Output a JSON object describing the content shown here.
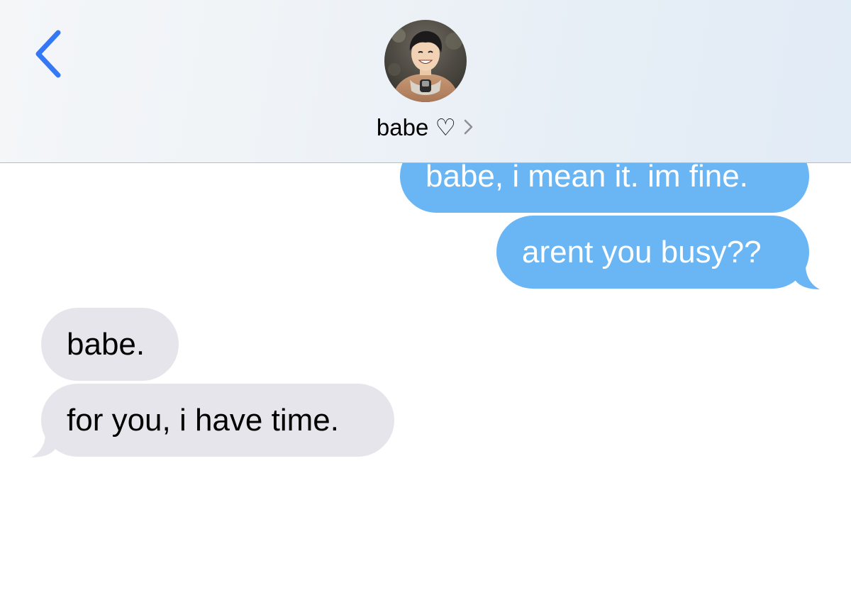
{
  "header": {
    "back_icon": "chevron-left-icon",
    "contact_name": "babe ♡",
    "details_icon": "chevron-right-icon",
    "avatar_icon": "contact-avatar-photo"
  },
  "messages": [
    {
      "direction": "sent",
      "text": "babe, i mean it. im fine.",
      "tail": false
    },
    {
      "direction": "sent",
      "text": "arent you busy??",
      "tail": true
    },
    {
      "direction": "received",
      "text": "babe.",
      "tail": false
    },
    {
      "direction": "received",
      "text": "for you, i have time.",
      "tail": true
    }
  ],
  "colors": {
    "accent": "#3478f6",
    "sent_bubble": "#6ab6f5",
    "received_bubble": "#e6e5eb"
  }
}
